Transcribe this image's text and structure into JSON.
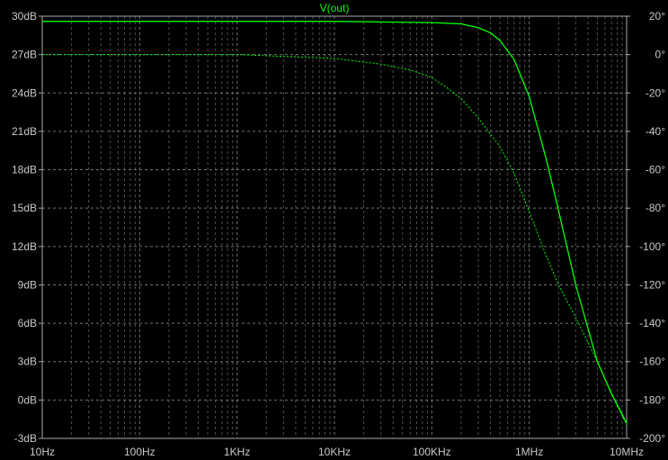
{
  "chart_data": {
    "type": "line",
    "title": "V(out)",
    "x_scale": "log",
    "xlim_hz": [
      10,
      10000000
    ],
    "x_tick_labels": [
      "10Hz",
      "100Hz",
      "1KHz",
      "10KHz",
      "100KHz",
      "1MHz",
      "10MHz"
    ],
    "y_left": {
      "label": "",
      "unit": "dB",
      "ylim": [
        -3,
        30
      ],
      "tick_labels": [
        "30dB",
        "27dB",
        "24dB",
        "21dB",
        "18dB",
        "15dB",
        "12dB",
        "9dB",
        "6dB",
        "3dB",
        "0dB",
        "-3dB"
      ]
    },
    "y_right": {
      "label": "",
      "unit": "degrees",
      "ylim": [
        -200,
        20
      ],
      "tick_labels": [
        "20°",
        "0°",
        "-20°",
        "-40°",
        "-60°",
        "-80°",
        "-100°",
        "-120°",
        "-140°",
        "-160°",
        "-180°",
        "-200°"
      ]
    },
    "grid": true,
    "series": [
      {
        "axis": "left",
        "style": "solid",
        "color": "#00ff00",
        "x": [
          10,
          1000,
          10000,
          100000,
          200000,
          300000,
          400000,
          500000,
          700000,
          1000000,
          1500000,
          2000000,
          3000000,
          5000000,
          7000000,
          10000000
        ],
        "values": [
          29.6,
          29.6,
          29.6,
          29.5,
          29.4,
          29.1,
          28.7,
          28.1,
          26.6,
          23.7,
          18.8,
          14.8,
          9.0,
          3.0,
          0.5,
          -1.8
        ]
      },
      {
        "axis": "right",
        "style": "dashed",
        "color": "#00ff00",
        "x": [
          10,
          1000,
          10000,
          30000,
          60000,
          100000,
          150000,
          200000,
          300000,
          500000,
          700000,
          1000000,
          1500000,
          2000000,
          3000000,
          5000000,
          7000000,
          10000000
        ],
        "values": [
          0,
          0,
          -2,
          -5,
          -8,
          -12,
          -18,
          -23,
          -33,
          -48,
          -62,
          -82,
          -105,
          -120,
          -137,
          -160,
          -177,
          -193
        ]
      }
    ]
  }
}
